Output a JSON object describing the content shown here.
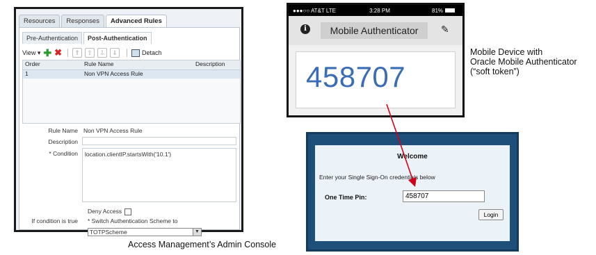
{
  "console": {
    "tabs": [
      "Resources",
      "Responses",
      "Advanced Rules"
    ],
    "subtabs": [
      "Pre-Authentication",
      "Post-Authentication"
    ],
    "toolbar": {
      "view": "View",
      "detach": "Detach"
    },
    "grid": {
      "headers": [
        "Order",
        "Rule Name",
        "Description"
      ],
      "rows": [
        {
          "order": "1",
          "rule_name": "Non VPN Access Rule",
          "description": ""
        }
      ]
    },
    "form": {
      "rule_name_label": "Rule Name",
      "rule_name_value": "Non VPN Access Rule",
      "description_label": "Description",
      "condition_label": "* Condition",
      "condition_value": "location.clientIP.startsWith('10.1')",
      "deny_access_label": "Deny Access",
      "if_true_label": "If condition is true",
      "switch_label": "* Switch Authentication Scheme to",
      "scheme_value": "TOTPScheme"
    }
  },
  "phone": {
    "status": {
      "carrier": "●●●○○ AT&T  LTE",
      "time": "3:28 PM",
      "battery": "81%"
    },
    "app_title": "Mobile Authenticator",
    "code": "458707"
  },
  "captions": {
    "device": [
      "Mobile Device with",
      "Oracle Mobile Authenticator",
      "(“soft token”)"
    ],
    "console": "Access Management’s Admin Console"
  },
  "login": {
    "welcome": "Welcome",
    "instructions": "Enter your Single Sign-On credentials below",
    "otp_label": "One Time Pin:",
    "otp_value": "458707",
    "login_button": "Login"
  },
  "colors": {
    "arrow": "#d0021b",
    "code": "#3b6db5",
    "login_frame": "#1e4f7a"
  }
}
